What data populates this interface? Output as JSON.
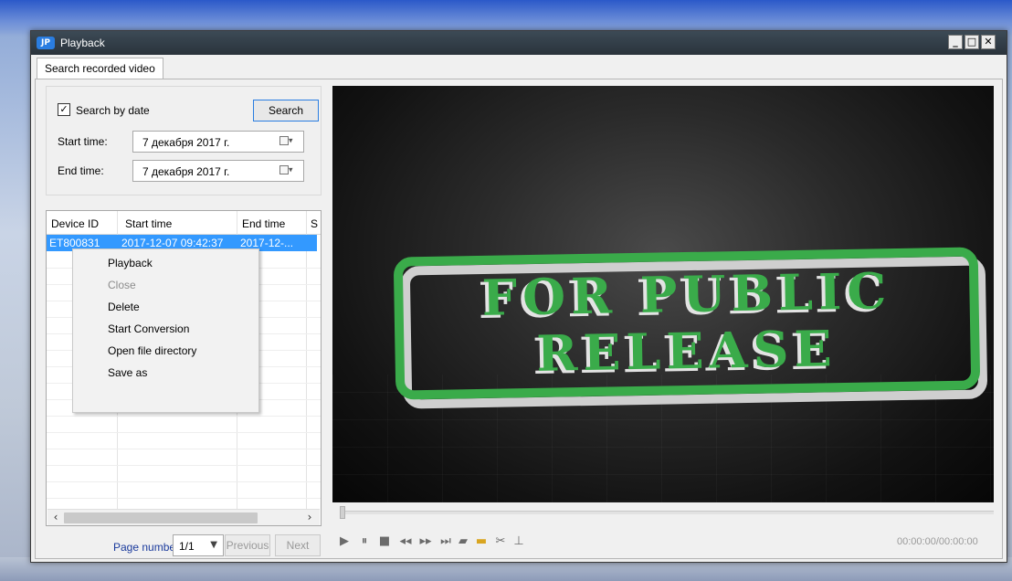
{
  "window": {
    "title": "Playback"
  },
  "tabs": [
    {
      "label": "Search recorded video"
    }
  ],
  "search": {
    "search_by_date_label": "Search by date",
    "search_by_date_checked": true,
    "search_button": "Search",
    "start_time_label": "Start time:",
    "start_time_value": "7 декабря  2017 г.",
    "end_time_label": "End time:",
    "end_time_value": "7 декабря  2017 г."
  },
  "list": {
    "columns": [
      "Device ID",
      "Start time",
      "End time",
      "S"
    ],
    "rows": [
      {
        "device_id": "ET800831",
        "start_time": "2017-12-07 09:42:37",
        "end_time": "2017-12-..."
      }
    ]
  },
  "context_menu": {
    "items": [
      {
        "label": "Playback",
        "enabled": true
      },
      {
        "label": "Close",
        "enabled": false
      },
      {
        "label": "Delete",
        "enabled": true
      },
      {
        "label": "Start Conversion",
        "enabled": true
      },
      {
        "label": "Open file directory",
        "enabled": true
      },
      {
        "label": "Save as",
        "enabled": true
      }
    ]
  },
  "pager": {
    "label": "Page number:",
    "page_value": "1/1",
    "previous": "Previous",
    "next": "Next"
  },
  "video": {
    "overlay_line1": "FOR PUBLIC",
    "overlay_line2": "RELEASE",
    "overlay_color": "#3aab4a",
    "progress": 0
  },
  "player": {
    "controls": [
      "play-icon",
      "pause-icon",
      "stop-icon",
      "rewind-icon",
      "fast-forward-icon",
      "step-frame-icon",
      "record-icon",
      "open-folder-icon",
      "cut-icon",
      "clip-icon"
    ],
    "timecode": "00:00:00/00:00:00"
  },
  "colors": {
    "accent": "#2a7de1",
    "selection": "#3399ff",
    "titlebar": "#2a333b"
  }
}
